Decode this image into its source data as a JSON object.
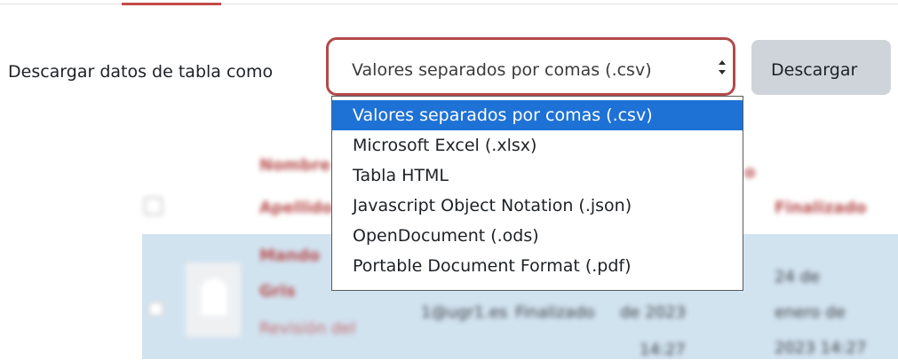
{
  "download": {
    "label": "Descargar datos de tabla como",
    "selected_value": "Valores separados por comas (.csv)",
    "button_label": "Descargar",
    "options": [
      "Valores separados por comas (.csv)",
      "Microsoft Excel (.xlsx)",
      "Tabla HTML",
      "Javascript Object Notation (.json)",
      "OpenDocument (.ods)",
      "Portable Document Format (.pdf)"
    ],
    "selected_index": 0
  },
  "colors": {
    "accent": "#b24a4a",
    "selection": "#1e72d6",
    "button_bg": "#ced4da",
    "row_highlight": "#d2e3f0"
  },
  "icons": {
    "select_arrows": "up-down-chevron-icon",
    "avatar": "user-avatar-icon"
  }
}
